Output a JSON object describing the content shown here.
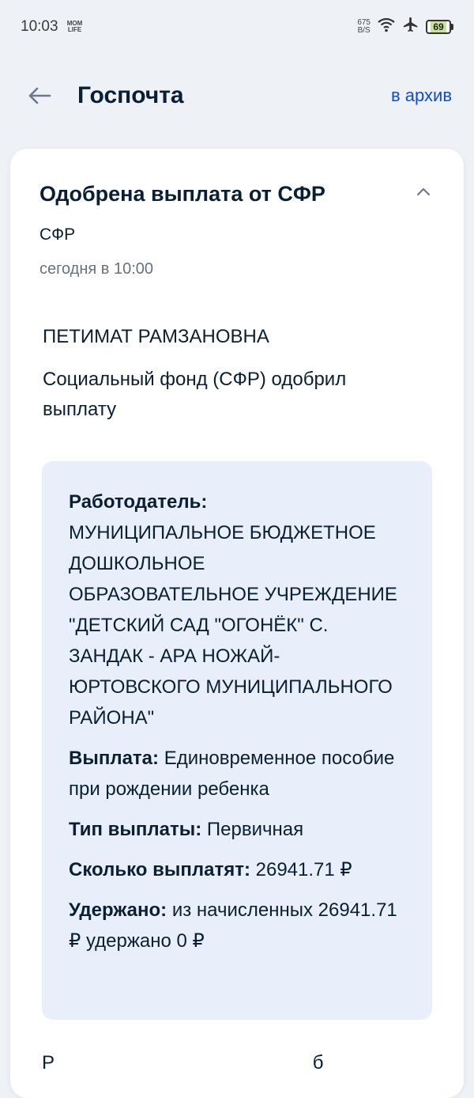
{
  "status": {
    "time": "10:03",
    "app_badge": "MOM LIFE",
    "net_speed_value": "675",
    "net_speed_unit": "B/S",
    "battery": "69"
  },
  "header": {
    "title": "Госпочта",
    "archive_label": "в архив"
  },
  "message": {
    "title": "Одобрена выплата от СФР",
    "sender": "СФР",
    "datetime": "сегодня в 10:00",
    "recipient": "ПЕТИМАТ РАМЗАНОВНА",
    "intro": "Социальный фонд (СФР) одобрил выплату",
    "details": {
      "employer_label": "Работодатель:",
      "employer_value": "МУНИЦИПАЛЬНОЕ БЮДЖЕТНОЕ ДОШКОЛЬНОЕ ОБРАЗОВАТЕЛЬНОЕ УЧРЕЖДЕНИЕ \"ДЕТСКИЙ САД \"ОГОНЁК\" С. ЗАНДАК - АРА НОЖАЙ-ЮРТОВСКОГО МУНИЦИПАЛЬНОГО РАЙОНА\"",
      "payment_label": "Выплата:",
      "payment_value": "Единовременное пособие при рождении ребенка",
      "type_label": "Тип выплаты:",
      "type_value": "Первичная",
      "amount_label": "Сколько выплатят:",
      "amount_value": "26941.71 ₽",
      "withheld_label": "Удержано:",
      "withheld_value": "из начисленных 26941.71 ₽ удержано 0 ₽"
    },
    "footer_partial": "Р                                                 б"
  },
  "colors": {
    "accent": "#0d4cd3",
    "background": "#eef1f6",
    "details_bg": "#e8effb",
    "muted_text": "#66727f"
  }
}
